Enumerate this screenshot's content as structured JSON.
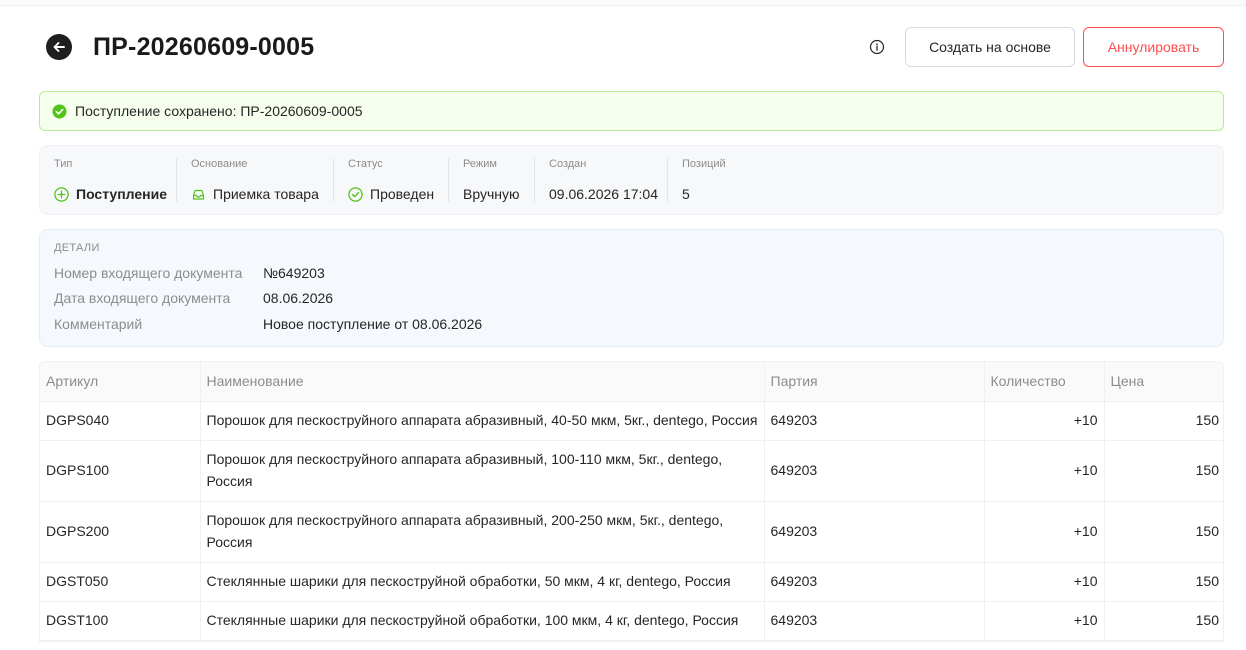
{
  "header": {
    "title": "ПР-20260609-0005",
    "create_based_label": "Создать на основе",
    "cancel_label": "Аннулировать"
  },
  "alert": {
    "text": "Поступление сохранено: ПР-20260609-0005"
  },
  "props": {
    "type": {
      "label": "Тип",
      "value": "Поступление"
    },
    "basis": {
      "label": "Основание",
      "value": "Приемка товара"
    },
    "status": {
      "label": "Статус",
      "value": "Проведен"
    },
    "mode": {
      "label": "Режим",
      "value": "Вручную"
    },
    "created": {
      "label": "Создан",
      "value": "09.06.2026 17:04"
    },
    "positions": {
      "label": "Позиций",
      "value": "5"
    }
  },
  "details": {
    "title": "ДЕТАЛИ",
    "rows": [
      {
        "label": "Номер входящего документа",
        "value": "№649203"
      },
      {
        "label": "Дата входящего документа",
        "value": "08.06.2026"
      },
      {
        "label": "Комментарий",
        "value": "Новое поступление от 08.06.2026"
      }
    ]
  },
  "table": {
    "columns": [
      "Артикул",
      "Наименование",
      "Партия",
      "Количество",
      "Цена"
    ],
    "rows": [
      {
        "sku": "DGPS040",
        "name": "Порошок для пескоструйного аппарата абразивный, 40-50 мкм, 5кг., dentego, Россия",
        "batch": "649203",
        "qty": "+10",
        "price": "150"
      },
      {
        "sku": "DGPS100",
        "name": "Порошок для пескоструйного аппарата абразивный, 100-110 мкм, 5кг., dentego, Россия",
        "batch": "649203",
        "qty": "+10",
        "price": "150"
      },
      {
        "sku": "DGPS200",
        "name": "Порошок для пескоструйного аппарата абразивный, 200-250 мкм, 5кг., dentego, Россия",
        "batch": "649203",
        "qty": "+10",
        "price": "150"
      },
      {
        "sku": "DGST050",
        "name": "Стеклянные шарики для пескоструйной обработки, 50 мкм, 4 кг, dentego, Россия",
        "batch": "649203",
        "qty": "+10",
        "price": "150"
      },
      {
        "sku": "DGST100",
        "name": "Стеклянные шарики для пескоструйной обработки, 100 мкм, 4 кг, dentego, Россия",
        "batch": "649203",
        "qty": "+10",
        "price": "150"
      }
    ]
  },
  "icons": {
    "back": "arrow-left-icon",
    "info": "info-circle-icon",
    "alert": "check-circle-icon",
    "type": "plus-circle-icon",
    "basis": "inbox-icon",
    "status": "check-circle-outline-icon"
  },
  "colors": {
    "success": "#52c41a",
    "danger": "#ff4d4f",
    "alert_bg": "#f6ffed",
    "alert_border": "#b7eb8f"
  }
}
